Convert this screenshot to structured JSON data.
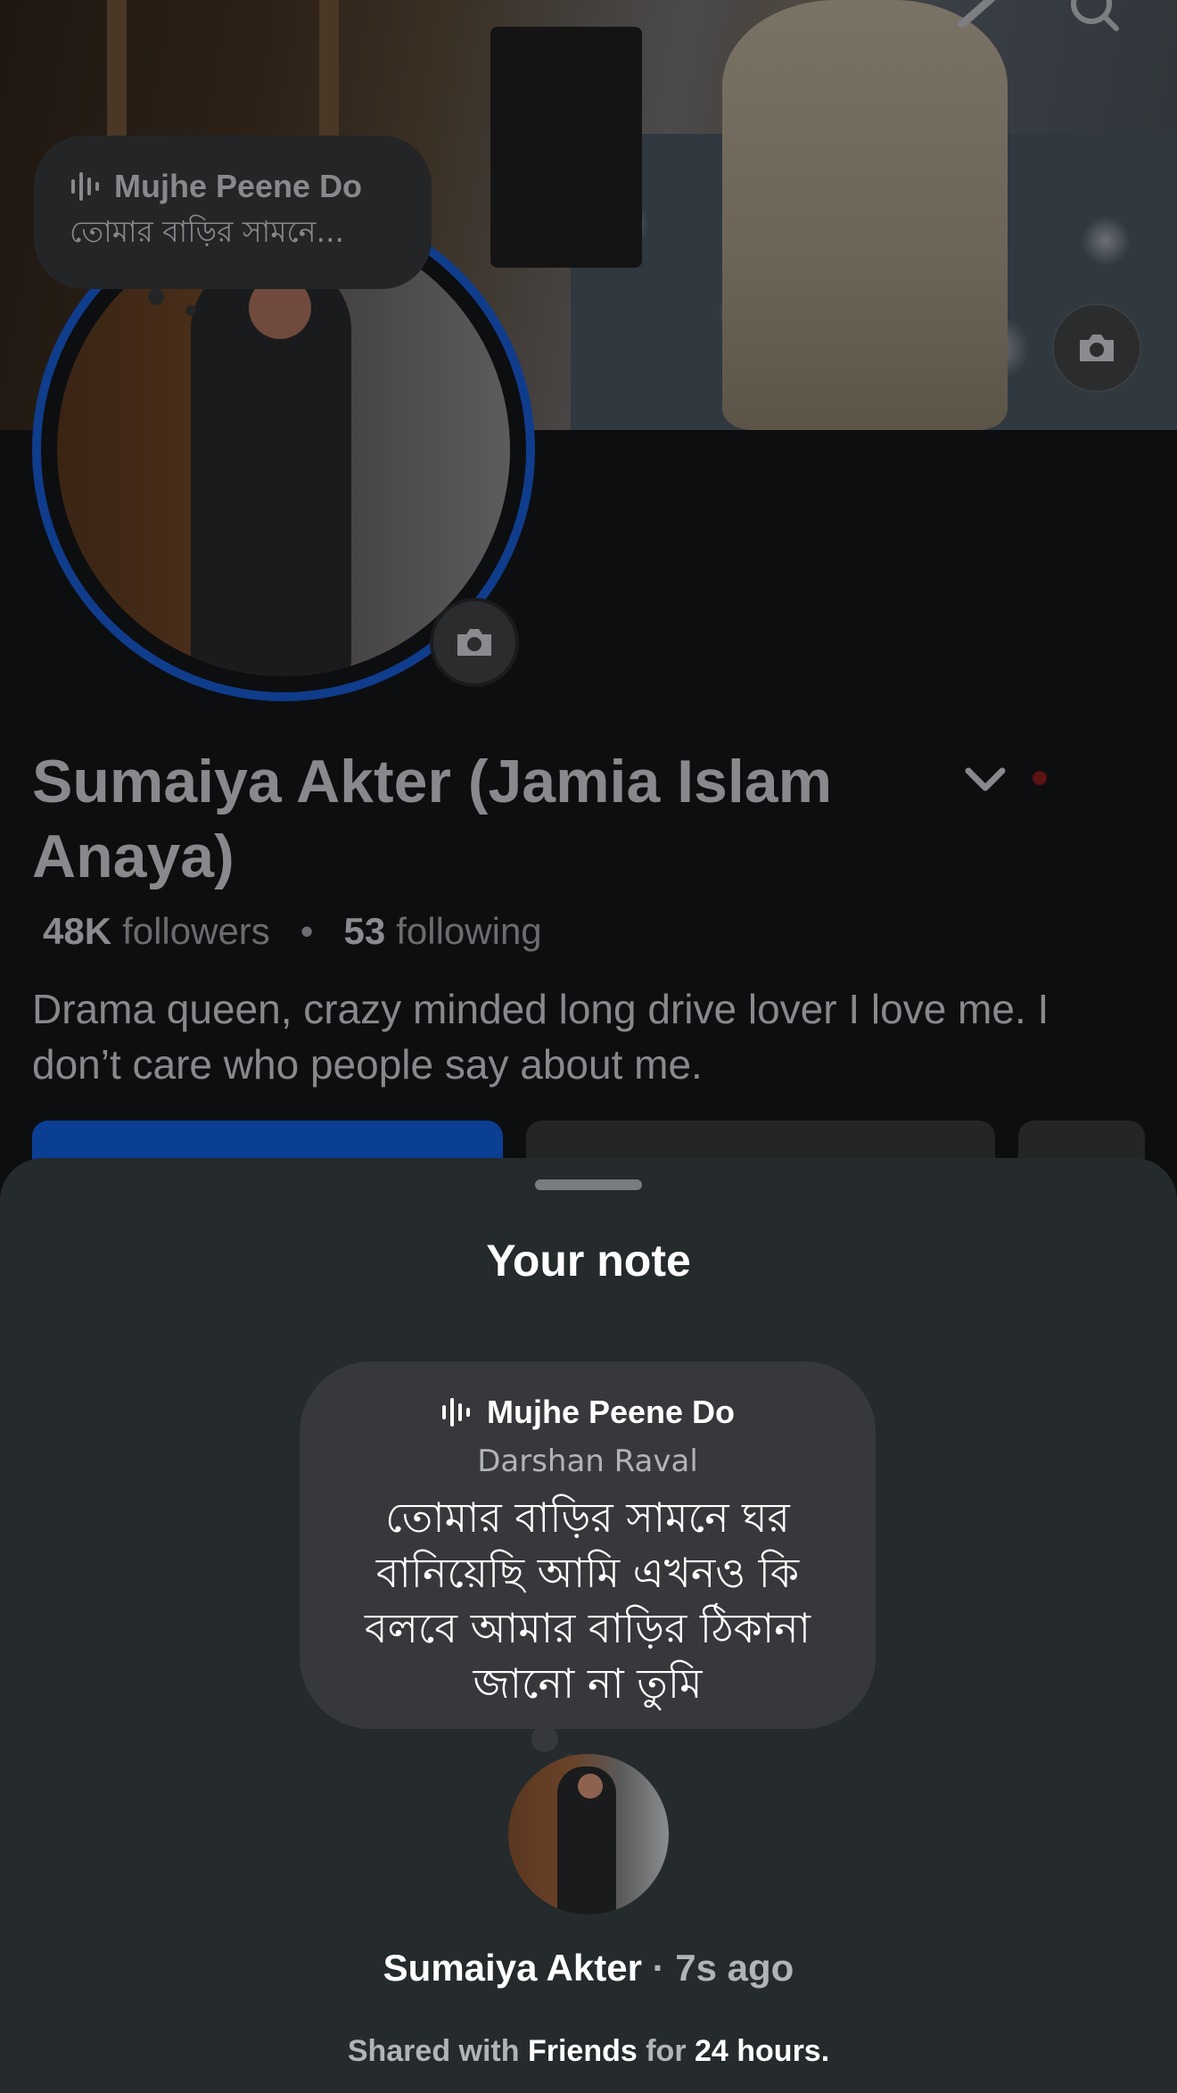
{
  "profile": {
    "note": {
      "song_title": "Mujhe Peene Do",
      "text_preview": "তোমার বাড়ির সামনে..."
    },
    "name": "Sumaiya Akter (Jamia Islam Anaya)",
    "stats": {
      "followers_count": "48K",
      "followers_label": "followers",
      "separator": "•",
      "following_count": "53",
      "following_label": "following"
    },
    "bio": "Drama queen, crazy minded long drive lover I love me. I don’t care who people say about me."
  },
  "sheet": {
    "title": "Your note",
    "note": {
      "song_title": "Mujhe Peene Do",
      "artist": "Darshan Raval",
      "text": "তোমার বাড়ির সামনে ঘর বানিয়েছি আমি এখনও কি বলবে আমার বাড়ির ঠিকানা জানো না তুমি"
    },
    "author": {
      "name": "Sumaiya Akter",
      "time": "· 7s ago"
    },
    "shared": {
      "prefix": "Shared with ",
      "audience": "Friends",
      "middle": " for ",
      "duration": "24 hours."
    }
  },
  "colors": {
    "accent_blue": "#0a3f94",
    "sheet_bg": "#252a2c",
    "bubble_bg": "#37383b"
  },
  "icons": [
    "pencil-icon",
    "search-icon",
    "camera-icon",
    "music-waveform-icon",
    "chevron-down-icon"
  ]
}
